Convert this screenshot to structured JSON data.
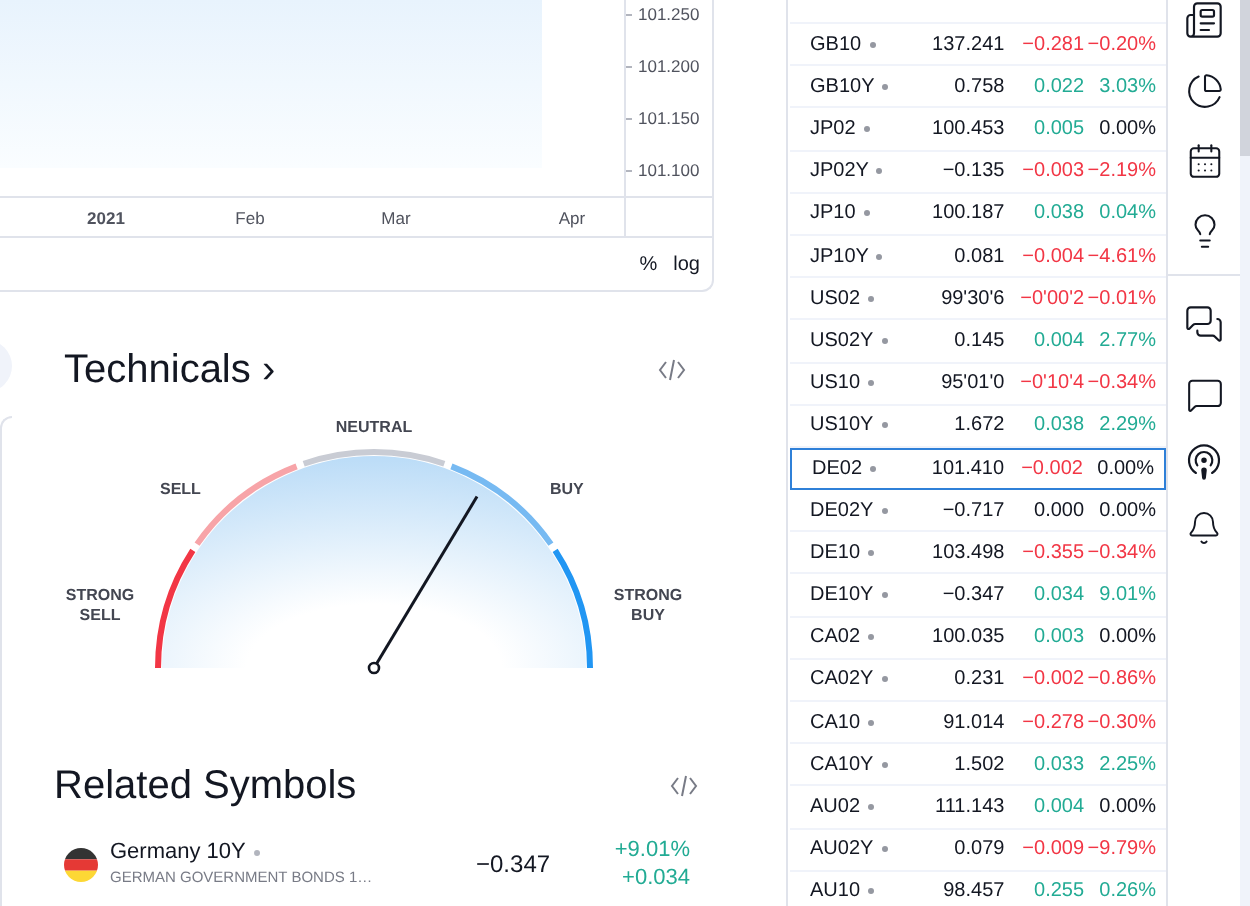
{
  "chart": {
    "y_axis": [
      "101.250",
      "101.200",
      "101.150",
      "101.100"
    ],
    "x_axis": [
      "2021",
      "Feb",
      "Mar",
      "Apr"
    ],
    "scale_buttons": [
      {
        "label": "%",
        "selected": false
      },
      {
        "label": "log",
        "selected": false
      }
    ]
  },
  "technicals": {
    "title": "Technicals",
    "arrow": "›",
    "labels": {
      "strong_sell": "STRONG SELL",
      "sell": "SELL",
      "neutral": "NEUTRAL",
      "buy": "BUY",
      "strong_buy": "STRONG BUY"
    }
  },
  "related": {
    "title": "Related Symbols",
    "items": [
      {
        "name": "Germany 10Y",
        "description": "GERMAN GOVERNMENT BONDS 1…",
        "last": "−0.347",
        "change_pct": {
          "text": "+9.01%",
          "color": "#22ab94"
        },
        "change": {
          "text": "+0.034",
          "color": "#22ab94"
        }
      }
    ]
  },
  "watchlist": [
    {
      "symbol": "GB10",
      "last": "137.241",
      "change": {
        "text": "−0.281",
        "color": "#f23645"
      },
      "change_pct": {
        "text": "−0.20%",
        "color": "#f23645"
      },
      "selected": false
    },
    {
      "symbol": "GB10Y",
      "last": "0.758",
      "change": {
        "text": "0.022",
        "color": "#22ab94"
      },
      "change_pct": {
        "text": "3.03%",
        "color": "#22ab94"
      },
      "selected": false
    },
    {
      "symbol": "JP02",
      "last": "100.453",
      "change": {
        "text": "0.005",
        "color": "#22ab94"
      },
      "change_pct": {
        "text": "0.00%",
        "color": "#131722"
      },
      "selected": false
    },
    {
      "symbol": "JP02Y",
      "last": "−0.135",
      "change": {
        "text": "−0.003",
        "color": "#f23645"
      },
      "change_pct": {
        "text": "−2.19%",
        "color": "#f23645"
      },
      "selected": false
    },
    {
      "symbol": "JP10",
      "last": "100.187",
      "change": {
        "text": "0.038",
        "color": "#22ab94"
      },
      "change_pct": {
        "text": "0.04%",
        "color": "#22ab94"
      },
      "selected": false
    },
    {
      "symbol": "JP10Y",
      "last": "0.081",
      "change": {
        "text": "−0.004",
        "color": "#f23645"
      },
      "change_pct": {
        "text": "−4.61%",
        "color": "#f23645"
      },
      "selected": false
    },
    {
      "symbol": "US02",
      "last": "99'30'6",
      "change": {
        "text": "−0'00'2",
        "color": "#f23645"
      },
      "change_pct": {
        "text": "−0.01%",
        "color": "#f23645"
      },
      "selected": false
    },
    {
      "symbol": "US02Y",
      "last": "0.145",
      "change": {
        "text": "0.004",
        "color": "#22ab94"
      },
      "change_pct": {
        "text": "2.77%",
        "color": "#22ab94"
      },
      "selected": false
    },
    {
      "symbol": "US10",
      "last": "95'01'0",
      "change": {
        "text": "−0'10'4",
        "color": "#f23645"
      },
      "change_pct": {
        "text": "−0.34%",
        "color": "#f23645"
      },
      "selected": false
    },
    {
      "symbol": "US10Y",
      "last": "1.672",
      "change": {
        "text": "0.038",
        "color": "#22ab94"
      },
      "change_pct": {
        "text": "2.29%",
        "color": "#22ab94"
      },
      "selected": false
    },
    {
      "symbol": "DE02",
      "last": "101.410",
      "change": {
        "text": "−0.002",
        "color": "#f23645"
      },
      "change_pct": {
        "text": "0.00%",
        "color": "#131722"
      },
      "selected": true
    },
    {
      "symbol": "DE02Y",
      "last": "−0.717",
      "change": {
        "text": "0.000",
        "color": "#131722"
      },
      "change_pct": {
        "text": "0.00%",
        "color": "#131722"
      },
      "selected": false
    },
    {
      "symbol": "DE10",
      "last": "103.498",
      "change": {
        "text": "−0.355",
        "color": "#f23645"
      },
      "change_pct": {
        "text": "−0.34%",
        "color": "#f23645"
      },
      "selected": false
    },
    {
      "symbol": "DE10Y",
      "last": "−0.347",
      "change": {
        "text": "0.034",
        "color": "#22ab94"
      },
      "change_pct": {
        "text": "9.01%",
        "color": "#22ab94"
      },
      "selected": false
    },
    {
      "symbol": "CA02",
      "last": "100.035",
      "change": {
        "text": "0.003",
        "color": "#22ab94"
      },
      "change_pct": {
        "text": "0.00%",
        "color": "#131722"
      },
      "selected": false
    },
    {
      "symbol": "CA02Y",
      "last": "0.231",
      "change": {
        "text": "−0.002",
        "color": "#f23645"
      },
      "change_pct": {
        "text": "−0.86%",
        "color": "#f23645"
      },
      "selected": false
    },
    {
      "symbol": "CA10",
      "last": "91.014",
      "change": {
        "text": "−0.278",
        "color": "#f23645"
      },
      "change_pct": {
        "text": "−0.30%",
        "color": "#f23645"
      },
      "selected": false
    },
    {
      "symbol": "CA10Y",
      "last": "1.502",
      "change": {
        "text": "0.033",
        "color": "#22ab94"
      },
      "change_pct": {
        "text": "2.25%",
        "color": "#22ab94"
      },
      "selected": false
    },
    {
      "symbol": "AU02",
      "last": "111.143",
      "change": {
        "text": "0.004",
        "color": "#22ab94"
      },
      "change_pct": {
        "text": "0.00%",
        "color": "#131722"
      },
      "selected": false
    },
    {
      "symbol": "AU02Y",
      "last": "0.079",
      "change": {
        "text": "−0.009",
        "color": "#f23645"
      },
      "change_pct": {
        "text": "−9.79%",
        "color": "#f23645"
      },
      "selected": false
    },
    {
      "symbol": "AU10",
      "last": "98.457",
      "change": {
        "text": "0.255",
        "color": "#22ab94"
      },
      "change_pct": {
        "text": "0.26%",
        "color": "#22ab94"
      },
      "selected": false
    }
  ]
}
